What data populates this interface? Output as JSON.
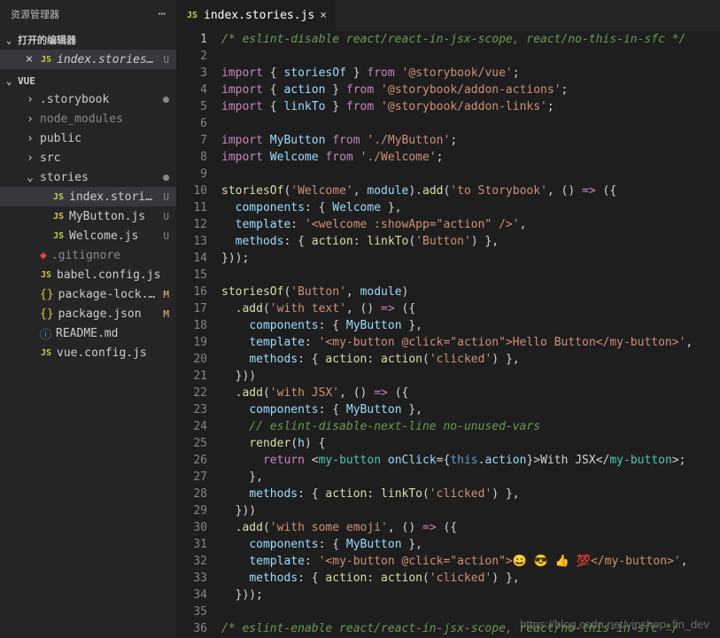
{
  "sidebar": {
    "title": "资源管理器",
    "openEditors": {
      "title": "打开的编辑器"
    },
    "openFile": {
      "name": "index.stories.j...",
      "marker": "U"
    },
    "projectName": "VUE",
    "tree": [
      {
        "type": "folder",
        "name": ".storybook",
        "dim": false,
        "dot": true,
        "indent": 1
      },
      {
        "type": "folder",
        "name": "node_modules",
        "dim": true,
        "indent": 1
      },
      {
        "type": "folder",
        "name": "public",
        "dim": false,
        "indent": 1
      },
      {
        "type": "folder",
        "name": "src",
        "dim": false,
        "indent": 1
      },
      {
        "type": "folder",
        "name": "stories",
        "open": true,
        "dot": true,
        "indent": 1
      },
      {
        "type": "js",
        "name": "index.stories.js",
        "marker": "U",
        "indent": 2,
        "active": true
      },
      {
        "type": "js",
        "name": "MyButton.js",
        "marker": "U",
        "indent": 2
      },
      {
        "type": "js",
        "name": "Welcome.js",
        "marker": "U",
        "indent": 2
      },
      {
        "type": "git",
        "name": ".gitignore",
        "indent": 1,
        "dim": true
      },
      {
        "type": "js",
        "name": "babel.config.js",
        "indent": 1
      },
      {
        "type": "json",
        "name": "package-lock.json",
        "marker": "M",
        "indent": 1
      },
      {
        "type": "json",
        "name": "package.json",
        "marker": "M",
        "indent": 1
      },
      {
        "type": "readme",
        "name": "README.md",
        "indent": 1
      },
      {
        "type": "js",
        "name": "vue.config.js",
        "indent": 1
      }
    ]
  },
  "tab": {
    "name": "index.stories.js"
  },
  "code": {
    "lines": [
      [
        [
          "c-comment",
          "/* eslint-disable react/react-in-jsx-scope, react/no-this-in-sfc */"
        ]
      ],
      [],
      [
        [
          "c-kw",
          "import"
        ],
        [
          "c-punc",
          " { "
        ],
        [
          "c-var",
          "storiesOf"
        ],
        [
          "c-punc",
          " } "
        ],
        [
          "c-kw",
          "from"
        ],
        [
          "c-punc",
          " "
        ],
        [
          "c-str",
          "'@storybook/vue'"
        ],
        [
          "c-punc",
          ";"
        ]
      ],
      [
        [
          "c-kw",
          "import"
        ],
        [
          "c-punc",
          " { "
        ],
        [
          "c-var",
          "action"
        ],
        [
          "c-punc",
          " } "
        ],
        [
          "c-kw",
          "from"
        ],
        [
          "c-punc",
          " "
        ],
        [
          "c-str",
          "'@storybook/addon-actions'"
        ],
        [
          "c-punc",
          ";"
        ]
      ],
      [
        [
          "c-kw",
          "import"
        ],
        [
          "c-punc",
          " { "
        ],
        [
          "c-var",
          "linkTo"
        ],
        [
          "c-punc",
          " } "
        ],
        [
          "c-kw",
          "from"
        ],
        [
          "c-punc",
          " "
        ],
        [
          "c-str",
          "'@storybook/addon-links'"
        ],
        [
          "c-punc",
          ";"
        ]
      ],
      [],
      [
        [
          "c-kw",
          "import"
        ],
        [
          "c-punc",
          " "
        ],
        [
          "c-var",
          "MyButton"
        ],
        [
          "c-punc",
          " "
        ],
        [
          "c-kw",
          "from"
        ],
        [
          "c-punc",
          " "
        ],
        [
          "c-str",
          "'./MyButton'"
        ],
        [
          "c-punc",
          ";"
        ]
      ],
      [
        [
          "c-kw",
          "import"
        ],
        [
          "c-punc",
          " "
        ],
        [
          "c-var",
          "Welcome"
        ],
        [
          "c-punc",
          " "
        ],
        [
          "c-kw",
          "from"
        ],
        [
          "c-punc",
          " "
        ],
        [
          "c-str",
          "'./Welcome'"
        ],
        [
          "c-punc",
          ";"
        ]
      ],
      [],
      [
        [
          "c-fn",
          "storiesOf"
        ],
        [
          "c-punc",
          "("
        ],
        [
          "c-str",
          "'Welcome'"
        ],
        [
          "c-punc",
          ", "
        ],
        [
          "c-var",
          "module"
        ],
        [
          "c-punc",
          ")."
        ],
        [
          "c-fn",
          "add"
        ],
        [
          "c-punc",
          "("
        ],
        [
          "c-str",
          "'to Storybook'"
        ],
        [
          "c-punc",
          ", () "
        ],
        [
          "c-kw",
          "=>"
        ],
        [
          "c-punc",
          " ({"
        ]
      ],
      [
        [
          "c-punc",
          "  "
        ],
        [
          "c-prop",
          "components"
        ],
        [
          "c-punc",
          ": { "
        ],
        [
          "c-var",
          "Welcome"
        ],
        [
          "c-punc",
          " },"
        ]
      ],
      [
        [
          "c-punc",
          "  "
        ],
        [
          "c-prop",
          "template"
        ],
        [
          "c-punc",
          ": "
        ],
        [
          "c-str",
          "'<welcome :showApp=\"action\" />'"
        ],
        [
          "c-punc",
          ","
        ]
      ],
      [
        [
          "c-punc",
          "  "
        ],
        [
          "c-prop",
          "methods"
        ],
        [
          "c-punc",
          ": { "
        ],
        [
          "c-fn",
          "action"
        ],
        [
          "c-punc",
          ": "
        ],
        [
          "c-fn",
          "linkTo"
        ],
        [
          "c-punc",
          "("
        ],
        [
          "c-str",
          "'Button'"
        ],
        [
          "c-punc",
          ") },"
        ]
      ],
      [
        [
          "c-punc",
          "}));"
        ]
      ],
      [],
      [
        [
          "c-fn",
          "storiesOf"
        ],
        [
          "c-punc",
          "("
        ],
        [
          "c-str",
          "'Button'"
        ],
        [
          "c-punc",
          ", "
        ],
        [
          "c-var",
          "module"
        ],
        [
          "c-punc",
          ")"
        ]
      ],
      [
        [
          "c-punc",
          "  ."
        ],
        [
          "c-fn",
          "add"
        ],
        [
          "c-punc",
          "("
        ],
        [
          "c-str",
          "'with text'"
        ],
        [
          "c-punc",
          ", () "
        ],
        [
          "c-kw",
          "=>"
        ],
        [
          "c-punc",
          " ({"
        ]
      ],
      [
        [
          "c-punc",
          "    "
        ],
        [
          "c-prop",
          "components"
        ],
        [
          "c-punc",
          ": { "
        ],
        [
          "c-var",
          "MyButton"
        ],
        [
          "c-punc",
          " },"
        ]
      ],
      [
        [
          "c-punc",
          "    "
        ],
        [
          "c-prop",
          "template"
        ],
        [
          "c-punc",
          ": "
        ],
        [
          "c-str",
          "'<my-button @click=\"action\">Hello Button</my-button>'"
        ],
        [
          "c-punc",
          ","
        ]
      ],
      [
        [
          "c-punc",
          "    "
        ],
        [
          "c-prop",
          "methods"
        ],
        [
          "c-punc",
          ": { "
        ],
        [
          "c-fn",
          "action"
        ],
        [
          "c-punc",
          ": "
        ],
        [
          "c-fn",
          "action"
        ],
        [
          "c-punc",
          "("
        ],
        [
          "c-str",
          "'clicked'"
        ],
        [
          "c-punc",
          ") },"
        ]
      ],
      [
        [
          "c-punc",
          "  }))"
        ]
      ],
      [
        [
          "c-punc",
          "  ."
        ],
        [
          "c-fn",
          "add"
        ],
        [
          "c-punc",
          "("
        ],
        [
          "c-str",
          "'with JSX'"
        ],
        [
          "c-punc",
          ", () "
        ],
        [
          "c-kw",
          "=>"
        ],
        [
          "c-punc",
          " ({"
        ]
      ],
      [
        [
          "c-punc",
          "    "
        ],
        [
          "c-prop",
          "components"
        ],
        [
          "c-punc",
          ": { "
        ],
        [
          "c-var",
          "MyButton"
        ],
        [
          "c-punc",
          " },"
        ]
      ],
      [
        [
          "c-punc",
          "    "
        ],
        [
          "c-comment",
          "// eslint-disable-next-line no-unused-vars"
        ]
      ],
      [
        [
          "c-punc",
          "    "
        ],
        [
          "c-fn",
          "render"
        ],
        [
          "c-punc",
          "("
        ],
        [
          "c-var",
          "h"
        ],
        [
          "c-punc",
          ") {"
        ]
      ],
      [
        [
          "c-punc",
          "      "
        ],
        [
          "c-kw",
          "return"
        ],
        [
          "c-punc",
          " <"
        ],
        [
          "c-tag",
          "my-button"
        ],
        [
          "c-punc",
          " "
        ],
        [
          "c-attr",
          "onClick"
        ],
        [
          "c-punc",
          "={"
        ],
        [
          "c-this",
          "this"
        ],
        [
          "c-punc",
          "."
        ],
        [
          "c-var",
          "action"
        ],
        [
          "c-punc",
          "}>With JSX</"
        ],
        [
          "c-tag",
          "my-button"
        ],
        [
          "c-punc",
          ">;"
        ]
      ],
      [
        [
          "c-punc",
          "    },"
        ]
      ],
      [
        [
          "c-punc",
          "    "
        ],
        [
          "c-prop",
          "methods"
        ],
        [
          "c-punc",
          ": { "
        ],
        [
          "c-fn",
          "action"
        ],
        [
          "c-punc",
          ": "
        ],
        [
          "c-fn",
          "linkTo"
        ],
        [
          "c-punc",
          "("
        ],
        [
          "c-str",
          "'clicked'"
        ],
        [
          "c-punc",
          ") },"
        ]
      ],
      [
        [
          "c-punc",
          "  }))"
        ]
      ],
      [
        [
          "c-punc",
          "  ."
        ],
        [
          "c-fn",
          "add"
        ],
        [
          "c-punc",
          "("
        ],
        [
          "c-str",
          "'with some emoji'"
        ],
        [
          "c-punc",
          ", () "
        ],
        [
          "c-kw",
          "=>"
        ],
        [
          "c-punc",
          " ({"
        ]
      ],
      [
        [
          "c-punc",
          "    "
        ],
        [
          "c-prop",
          "components"
        ],
        [
          "c-punc",
          ": { "
        ],
        [
          "c-var",
          "MyButton"
        ],
        [
          "c-punc",
          " },"
        ]
      ],
      [
        [
          "c-punc",
          "    "
        ],
        [
          "c-prop",
          "template"
        ],
        [
          "c-punc",
          ": "
        ],
        [
          "c-str",
          "'<my-button @click=\"action\">😀 😎 👍 💯</my-button>'"
        ],
        [
          "c-punc",
          ","
        ]
      ],
      [
        [
          "c-punc",
          "    "
        ],
        [
          "c-prop",
          "methods"
        ],
        [
          "c-punc",
          ": { "
        ],
        [
          "c-fn",
          "action"
        ],
        [
          "c-punc",
          ": "
        ],
        [
          "c-fn",
          "action"
        ],
        [
          "c-punc",
          "("
        ],
        [
          "c-str",
          "'clicked'"
        ],
        [
          "c-punc",
          ") },"
        ]
      ],
      [
        [
          "c-punc",
          "  }));"
        ]
      ],
      [],
      [
        [
          "c-comment",
          "/* eslint-enable react/react-in-jsx-scope, react/no-this-in-sfc */"
        ]
      ]
    ]
  },
  "watermark": "https://blog.csdn.net/vipshop_fin_dev"
}
